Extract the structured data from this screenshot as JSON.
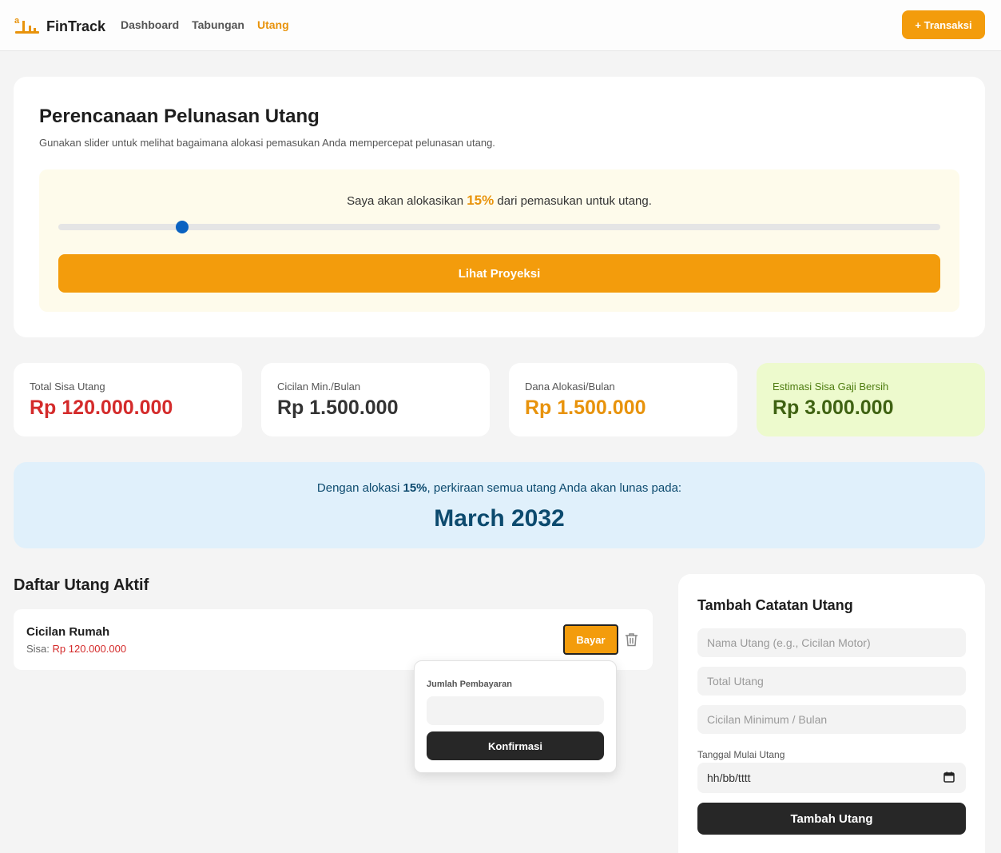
{
  "nav": {
    "brand": "FinTrack",
    "links": [
      {
        "label": "Dashboard",
        "active": false
      },
      {
        "label": "Tabungan",
        "active": false
      },
      {
        "label": "Utang",
        "active": true
      }
    ],
    "add_transaction": "+ Transaksi"
  },
  "planner": {
    "title": "Perencanaan Pelunasan Utang",
    "description": "Gunakan slider untuk melihat bagaimana alokasi pemasukan Anda mempercepat pelunasan utang.",
    "sentence_prefix": "Saya akan alokasikan",
    "percent": "15%",
    "sentence_suffix": "dari pemasukan untuk utang.",
    "slider_value_fraction": 0.14,
    "projection_button": "Lihat Proyeksi"
  },
  "stats": [
    {
      "label": "Total Sisa Utang",
      "value": "Rp 120.000.000"
    },
    {
      "label": "Cicilan Min./Bulan",
      "value": "Rp 1.500.000"
    },
    {
      "label": "Dana Alokasi/Bulan",
      "value": "Rp 1.500.000"
    },
    {
      "label": "Estimasi Sisa Gaji Bersih",
      "value": "Rp 3.000.000"
    }
  ],
  "projection": {
    "prefix": "Dengan alokasi",
    "percent": "15%",
    "suffix": ", perkiraan semua utang Anda akan lunas pada:",
    "date": "March 2032"
  },
  "debts": {
    "title": "Daftar Utang Aktif",
    "items": [
      {
        "name": "Cicilan Rumah",
        "remaining_label": "Sisa:",
        "remaining": "Rp 120.000.000",
        "pay_button": "Bayar"
      }
    ]
  },
  "payment_popover": {
    "label": "Jumlah Pembayaran",
    "value": "",
    "confirm_button": "Konfirmasi"
  },
  "add_form": {
    "title": "Tambah Catatan Utang",
    "name_placeholder": "Nama Utang (e.g., Cicilan Motor)",
    "total_placeholder": "Total Utang",
    "min_placeholder": "Cicilan Minimum / Bulan",
    "date_label": "Tanggal Mulai Utang",
    "date_placeholder": "hh/bb/tttt",
    "submit": "Tambah Utang"
  },
  "colors": {
    "accent": "#f39c0c",
    "slider_thumb": "#0a62c1",
    "danger": "#d42b2b",
    "dark_button": "#272727"
  }
}
